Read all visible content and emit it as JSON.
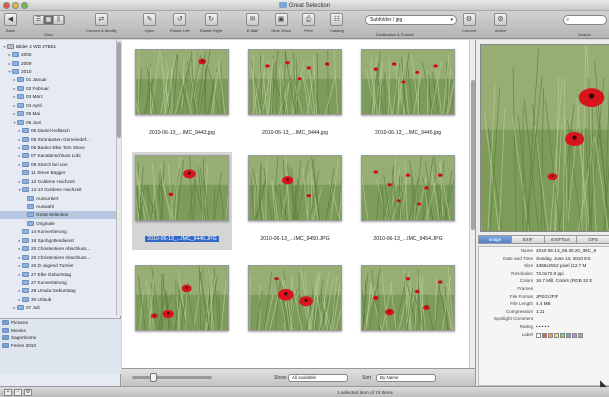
{
  "window": {
    "title": "Great Selection"
  },
  "toolbar": {
    "items": [
      {
        "name": "back-button",
        "icon": "left-arrow-icon",
        "glyph": "◀",
        "label": "Back"
      },
      {
        "name": "view-button",
        "icon": "view-icon",
        "glyph": "▦",
        "label": "View"
      },
      {
        "name": "convert-modify-button",
        "icon": "convert-icon",
        "glyph": "⇄",
        "label": "Convert & Modify"
      },
      {
        "name": "open-button",
        "icon": "open-icon",
        "glyph": "✎",
        "label": "Open"
      },
      {
        "name": "rotate-left-button",
        "icon": "rotate-left-icon",
        "glyph": "↺",
        "label": "Rotate Left"
      },
      {
        "name": "rotate-right-button",
        "icon": "rotate-right-icon",
        "glyph": "↻",
        "label": "Rotate Right"
      },
      {
        "name": "email-button",
        "icon": "email-icon",
        "glyph": "✉",
        "label": "E-Mail"
      },
      {
        "name": "slideshow-button",
        "icon": "slideshow-icon",
        "glyph": "▣",
        "label": "Slide Show"
      },
      {
        "name": "print-button",
        "icon": "print-icon",
        "glyph": "⎙",
        "label": "Print"
      },
      {
        "name": "catalog-button",
        "icon": "catalog-icon",
        "glyph": "☷",
        "label": "Catalog"
      }
    ],
    "destination": {
      "value": "Subfolder / jpg",
      "label": "Destination & Format"
    },
    "convert_label": "Convert",
    "action_label": "Action",
    "search_label": "Search",
    "search_placeholder": ""
  },
  "sidebar": {
    "tree": [
      {
        "label": "Bilder 2 WD 2TB01",
        "indent": 0,
        "open": true,
        "type": "drive"
      },
      {
        "label": "2006",
        "indent": 1,
        "open": false
      },
      {
        "label": "2009",
        "indent": 1,
        "open": false
      },
      {
        "label": "2010",
        "indent": 1,
        "open": true
      },
      {
        "label": "01 Januar",
        "indent": 2,
        "open": false
      },
      {
        "label": "02 Februar",
        "indent": 2,
        "open": false
      },
      {
        "label": "03 März",
        "indent": 2,
        "open": false
      },
      {
        "label": "04 April",
        "indent": 2,
        "open": false
      },
      {
        "label": "05 Mai",
        "indent": 2,
        "open": false
      },
      {
        "label": "06 Juni",
        "indent": 2,
        "open": true
      },
      {
        "label": "05 Daniel Kellasch",
        "indent": 3,
        "open": false
      },
      {
        "label": "05 Strönkarten Gemeindef...",
        "indent": 3,
        "open": false
      },
      {
        "label": "06 Baden Elke Tom Steve",
        "indent": 3,
        "open": false
      },
      {
        "label": "07 Kanalanschluss Lobi",
        "indent": 3,
        "open": false
      },
      {
        "label": "08 Storch bei uns",
        "indent": 3,
        "open": false
      },
      {
        "label": "11 Steve Bagger",
        "indent": 3,
        "open": null
      },
      {
        "label": "12 Goldene Hochzeit",
        "indent": 3,
        "open": false
      },
      {
        "label": "12-13 Goldene Hochzeit",
        "indent": 3,
        "open": true
      },
      {
        "label": "Aussortiert",
        "indent": 4,
        "open": null
      },
      {
        "label": "Auswahl",
        "indent": 4,
        "open": null
      },
      {
        "label": "Great Selection",
        "indent": 4,
        "open": null,
        "selected": true
      },
      {
        "label": "Originale",
        "indent": 4,
        "open": null
      },
      {
        "label": "14 Konvertierung",
        "indent": 3,
        "open": null
      },
      {
        "label": "18 Spohgottesdienst",
        "indent": 3,
        "open": false
      },
      {
        "label": "20 Christentiere Abschluss...",
        "indent": 3,
        "open": false
      },
      {
        "label": "25 Christentiere Abschluss...",
        "indent": 3,
        "open": false
      },
      {
        "label": "26 D-Jugend Turnier",
        "indent": 3,
        "open": false
      },
      {
        "label": "27 Elke Geburtstag",
        "indent": 3,
        "open": false
      },
      {
        "label": "27 Konvertierung",
        "indent": 3,
        "open": null
      },
      {
        "label": "28 Ursula Geburtstag",
        "indent": 3,
        "open": false
      },
      {
        "label": "30 Urlaub",
        "indent": 3,
        "open": false
      },
      {
        "label": "07 Juli",
        "indent": 2,
        "open": false
      }
    ],
    "favorites": [
      "Pictures",
      "Movies",
      "Sagenhome",
      "Ferien 2010"
    ]
  },
  "grid": {
    "items": [
      {
        "caption": "2010-06-13_...IMC_9443.jpg",
        "flowers": [
          [
            0.72,
            0.18,
            3.5
          ]
        ]
      },
      {
        "caption": "2010-06-13_...IMC_9444.jpg",
        "flowers": [
          [
            0.2,
            0.25,
            2
          ],
          [
            0.42,
            0.2,
            2
          ],
          [
            0.65,
            0.28,
            2
          ],
          [
            0.85,
            0.22,
            2
          ],
          [
            0.55,
            0.45,
            1.8
          ]
        ]
      },
      {
        "caption": "2010-06-13_...IMC_9445.jpg",
        "flowers": [
          [
            0.15,
            0.3,
            2
          ],
          [
            0.35,
            0.22,
            2
          ],
          [
            0.6,
            0.35,
            1.8
          ],
          [
            0.8,
            0.25,
            2
          ],
          [
            0.45,
            0.5,
            1.6
          ]
        ]
      },
      {
        "caption": "2010-06-13_...IMC_9446.JPG",
        "flowers": [
          [
            0.58,
            0.28,
            5.5
          ],
          [
            0.38,
            0.6,
            2.2
          ]
        ],
        "selected": true
      },
      {
        "caption": "2010-06-13_...IMC_9450.JPG",
        "flowers": [
          [
            0.42,
            0.38,
            5
          ],
          [
            0.65,
            0.62,
            2
          ]
        ]
      },
      {
        "caption": "2010-06-13_...IMC_9454.JPG",
        "flowers": [
          [
            0.15,
            0.25,
            2
          ],
          [
            0.3,
            0.45,
            2
          ],
          [
            0.5,
            0.3,
            2
          ],
          [
            0.7,
            0.5,
            2
          ],
          [
            0.85,
            0.3,
            2
          ],
          [
            0.4,
            0.7,
            1.8
          ],
          [
            0.62,
            0.75,
            1.8
          ]
        ]
      },
      {
        "caption": "",
        "flowers": [
          [
            0.55,
            0.35,
            4.5
          ],
          [
            0.35,
            0.75,
            5
          ],
          [
            0.2,
            0.78,
            3
          ]
        ]
      },
      {
        "caption": "",
        "flowers": [
          [
            0.4,
            0.45,
            7
          ],
          [
            0.62,
            0.55,
            6
          ],
          [
            0.3,
            0.2,
            2
          ]
        ]
      },
      {
        "caption": "",
        "flowers": [
          [
            0.15,
            0.5,
            2.5
          ],
          [
            0.3,
            0.72,
            4
          ],
          [
            0.6,
            0.4,
            2.2
          ],
          [
            0.7,
            0.65,
            3
          ],
          [
            0.85,
            0.25,
            2
          ],
          [
            0.5,
            0.2,
            2
          ]
        ]
      }
    ]
  },
  "bottombar": {
    "show_label": "Show",
    "show_value": "All available",
    "sort_label": "Sort",
    "sort_value": "By Name"
  },
  "status": {
    "text": "1 selected item of 74 items"
  },
  "inspector": {
    "tabs": [
      "Image",
      "EXIF",
      "EXIFTool",
      "GPS"
    ],
    "active_tab": "Image",
    "metadata": [
      {
        "key": "Name",
        "value": "2010-06-13_06.30.20_IMC_9"
      },
      {
        "key": "Date and Time",
        "value": "Sunday, June 13, 2010 8:5"
      },
      {
        "key": "Size",
        "value": "4368x2912 pixel (12.7 M"
      },
      {
        "key": "Resolution",
        "value": "72.0x72.0 ppi"
      },
      {
        "key": "Colors",
        "value": "16.7 Mill. Colors (RGB 32 E"
      },
      {
        "key": "Frames",
        "value": ""
      },
      {
        "key": "File Format",
        "value": "JPEG/JFIF"
      },
      {
        "key": "File Length",
        "value": "4.4 MB"
      },
      {
        "key": "Compression",
        "value": "1:11"
      },
      {
        "key": "Spotlight Comment",
        "value": ""
      },
      {
        "key": "Rating",
        "value": "• • • • •"
      },
      {
        "key": "Label",
        "value": ""
      }
    ],
    "label_colors": [
      "#ffffff",
      "#e45b5b",
      "#f0a43a",
      "#f2e25a",
      "#8cd36a",
      "#6aa6e6",
      "#b98ad9",
      "#aaaaaa"
    ]
  },
  "colors": {
    "selection": "#3569c6",
    "sidebar_bg": "#e6ebf3",
    "poppy_red": "#d8141c",
    "grass": "#7ea25a"
  }
}
